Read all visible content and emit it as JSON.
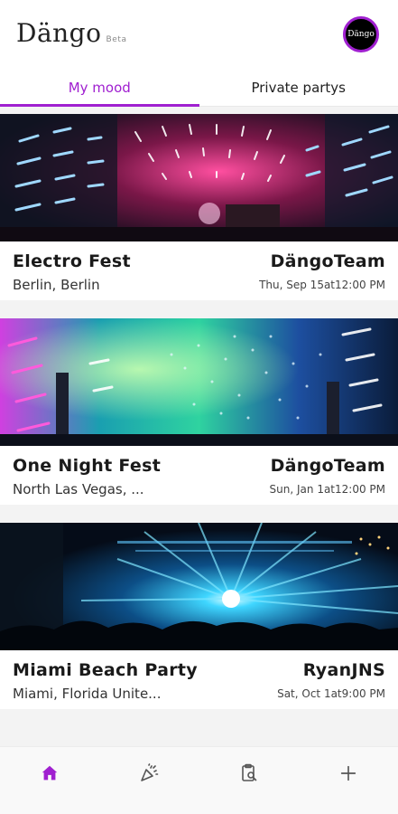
{
  "header": {
    "logo": "Dängo",
    "badge": "Beta",
    "avatar_text": "Dängo"
  },
  "tabs": [
    {
      "label": "My mood",
      "active": true
    },
    {
      "label": "Private partys",
      "active": false
    }
  ],
  "events": [
    {
      "name": "Electro Fest",
      "organizer": "DängoTeam",
      "location": "Berlin, Berlin",
      "date": "Thu, Sep 15at12:00 PM"
    },
    {
      "name": "One Night Fest",
      "organizer": "DängoTeam",
      "location": "North Las Vegas, ...",
      "date": "Sun, Jan 1at12:00 PM"
    },
    {
      "name": "Miami Beach Party",
      "organizer": "RyanJNS",
      "location": "Miami, Florida Unite...",
      "date": "Sat, Oct 1at9:00 PM"
    }
  ],
  "bottom_nav": [
    "home-icon",
    "party-popper-icon",
    "clipboard-search-icon",
    "plus-icon"
  ],
  "colors": {
    "accent": "#a020d0",
    "text": "#222222",
    "background": "#f3f3f3"
  }
}
